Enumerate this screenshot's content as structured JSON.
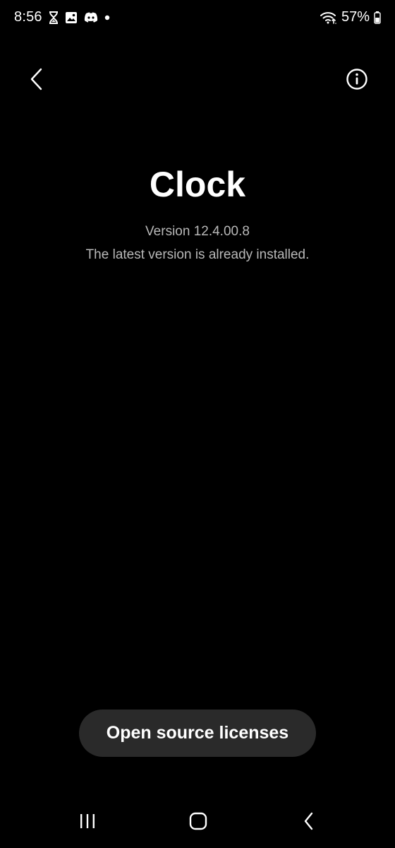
{
  "status_bar": {
    "time": "8:56",
    "icons": [
      "hourglass-icon",
      "image-icon",
      "discord-icon",
      "notification-dot-icon"
    ],
    "wifi_icon": "wifi-icon",
    "battery_percent": "57%",
    "battery_icon": "battery-icon"
  },
  "top_bar": {
    "back_icon": "chevron-left-icon",
    "info_icon": "info-icon"
  },
  "app": {
    "name": "Clock",
    "version": "Version 12.4.00.8",
    "update_status": "The latest version is already installed."
  },
  "actions": {
    "licenses_label": "Open source licenses"
  },
  "nav_bar": {
    "recents_icon": "recents-icon",
    "home_icon": "home-icon",
    "back_icon": "back-icon"
  },
  "colors": {
    "background": "#000000",
    "text_primary": "#ffffff",
    "text_secondary": "#b8b8b8",
    "button_bg": "#2a2a2a"
  }
}
